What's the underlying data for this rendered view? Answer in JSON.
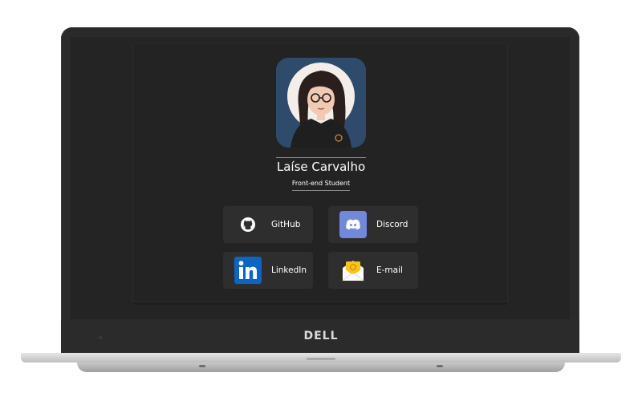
{
  "profile": {
    "name": "Laíse Carvalho",
    "role": "Front-end Student"
  },
  "links": {
    "github": {
      "label": "GitHub",
      "icon": "github-icon"
    },
    "discord": {
      "label": "Discord",
      "icon": "discord-icon",
      "color": "#7289da"
    },
    "linkedin": {
      "label": "LinkedIn",
      "icon": "linkedin-icon",
      "color": "#0a66c2"
    },
    "email": {
      "label": "E-mail",
      "icon": "envelope-icon",
      "color": "#f5c518"
    }
  },
  "device": {
    "brand": "DELL"
  }
}
